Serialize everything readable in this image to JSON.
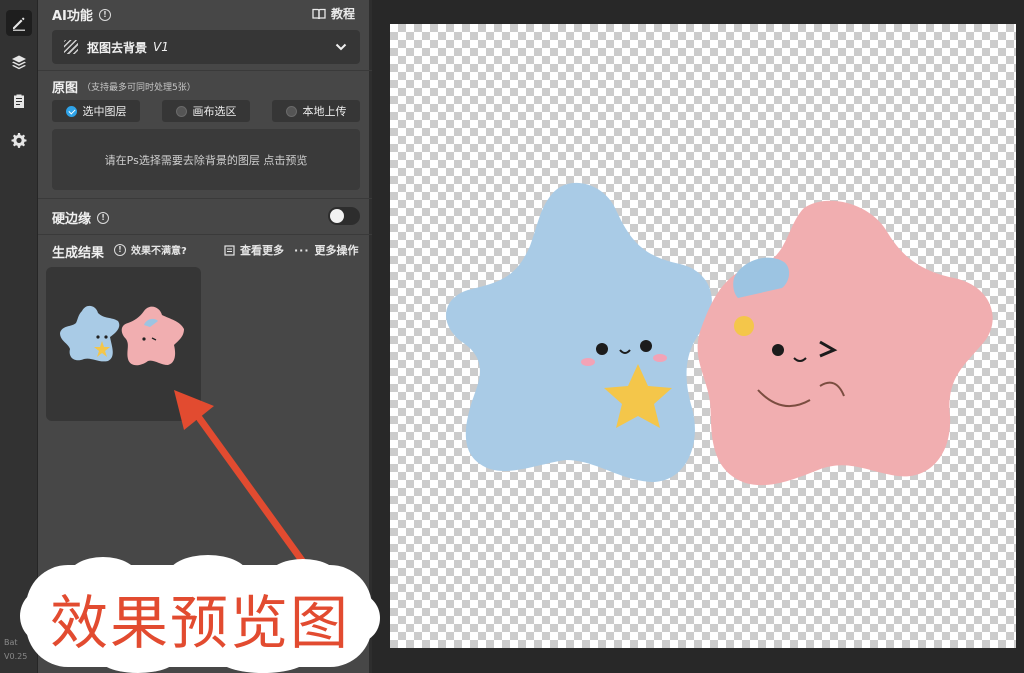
{
  "rail": {
    "version_line1": "Bat",
    "version_line2": "V0.25"
  },
  "ai": {
    "title": "AI功能",
    "tutorial_label": "教程",
    "feature_name": "抠图去背景",
    "feature_version": "V1"
  },
  "source": {
    "title": "原图",
    "note": "（支持最多可同时处理5张）",
    "options": [
      "选中图层",
      "画布选区",
      "本地上传"
    ],
    "selected_index": 0,
    "hint": "请在Ps选择需要去除背景的图层 点击预览"
  },
  "hard_edge": {
    "label": "硬边缘",
    "enabled": false
  },
  "result": {
    "title": "生成结果",
    "unsatisfied": "效果不满意?",
    "view_more": "查看更多",
    "more_actions": "更多操作"
  },
  "annotation": {
    "text": "效果预览图",
    "color": "#e24b30"
  },
  "colors": {
    "accent": "#2fa3e8",
    "blue_plush": "#a9cbe6",
    "pink_plush": "#f1aeb0",
    "yellow_star": "#f4c64a"
  }
}
